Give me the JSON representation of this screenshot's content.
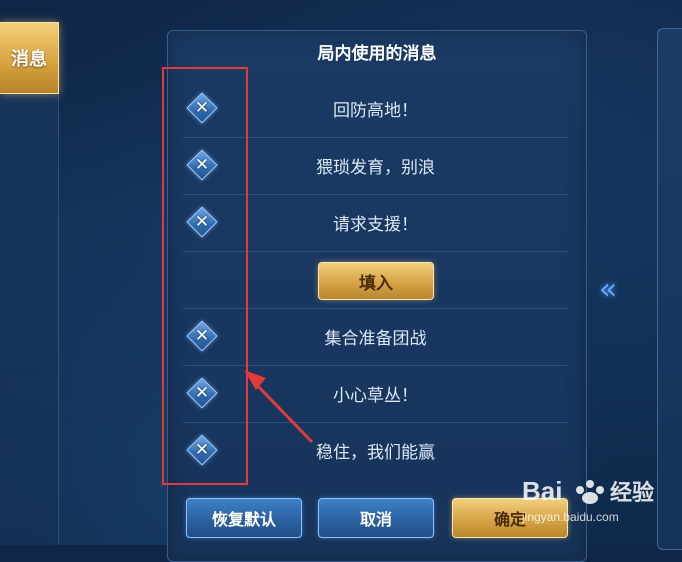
{
  "side_tab": {
    "label": "消息"
  },
  "panel": {
    "title": "局内使用的消息"
  },
  "messages": [
    {
      "text": "回防高地！"
    },
    {
      "text": "猥琐发育，别浪"
    },
    {
      "text": "请求支援！"
    },
    {
      "text": "集合准备团战"
    },
    {
      "text": "小心草丛！"
    },
    {
      "text": "稳住，我们能赢"
    }
  ],
  "fill_button": {
    "label": "填入"
  },
  "bottom_buttons": {
    "reset": "恢复默认",
    "cancel": "取消",
    "confirm": "确定"
  },
  "watermark": {
    "logo_text": "Bai 经验",
    "url": "jingyan.baidu.com"
  },
  "colors": {
    "annotation": "#e23a3a",
    "gold": "#d6a445",
    "blue_accent": "#5fa7ff"
  },
  "icons": {
    "delete": "close-diamond-icon",
    "expand": "double-chevron-left-icon"
  }
}
